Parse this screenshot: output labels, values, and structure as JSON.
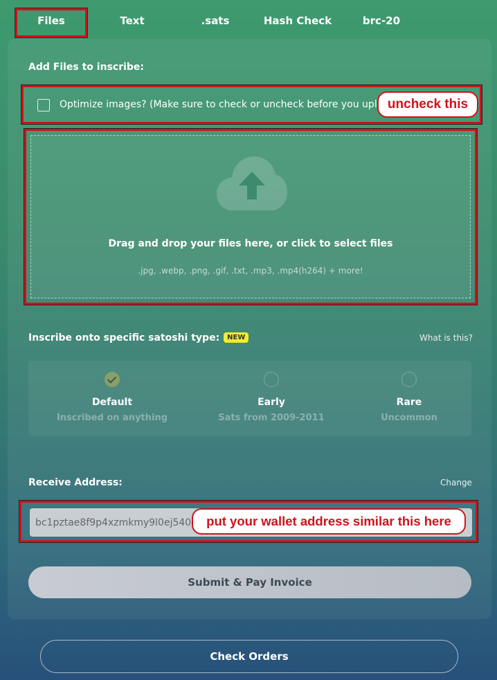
{
  "tabs": [
    {
      "label": "Files"
    },
    {
      "label": "Text"
    },
    {
      "label": ".sats"
    },
    {
      "label": "Hash Check"
    },
    {
      "label": "brc-20"
    }
  ],
  "add_files": {
    "heading": "Add Files to inscribe:",
    "optimize_label": "Optimize images? (Make sure to check or uncheck before you upload)",
    "drop_title": "Drag and drop your files here, or click to select files",
    "drop_types": ".jpg, .webp, .png, .gif, .txt, .mp3, .mp4(h264) + more!"
  },
  "satoshi": {
    "heading": "Inscribe onto specific satoshi type:",
    "badge": "NEW",
    "help_link": "What is this?",
    "options": [
      {
        "name": "Default",
        "desc": "Inscribed on anything",
        "selected": true
      },
      {
        "name": "Early",
        "desc": "Sats from 2009-2011",
        "selected": false
      },
      {
        "name": "Rare",
        "desc": "Uncommon",
        "selected": false
      }
    ]
  },
  "receive": {
    "heading": "Receive Address:",
    "change_link": "Change",
    "address": "bc1pztae8f9p4xzmkmy9l0ej540"
  },
  "buttons": {
    "submit": "Submit & Pay Invoice",
    "check_orders": "Check Orders"
  },
  "annotations": {
    "uncheck": "uncheck this",
    "wallet": "put your wallet address similar this here"
  },
  "colors": {
    "annotation_red": "#d0121b",
    "new_badge": "#f2ee2b"
  }
}
